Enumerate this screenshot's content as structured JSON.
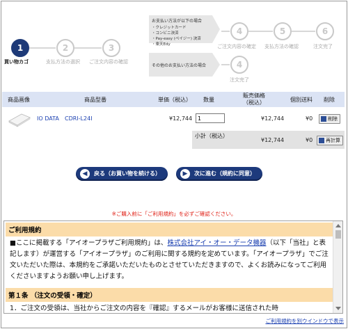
{
  "steps": {
    "s1": {
      "num": "1",
      "label": "買い物カゴ"
    },
    "s2": {
      "num": "2",
      "label": "支払方法の選択"
    },
    "s3": {
      "num": "3",
      "label": "ご注文内容の確認"
    },
    "pay_box_top": {
      "title": "お支払い方法が以下の場合",
      "items": [
        "・クレジットカード",
        "・コンビニ決済",
        "・Pay-easy (ペイジー) 決済",
        "・楽天Edy"
      ]
    },
    "pay_box_bottom": {
      "title": "その他のお支払い方法の場合"
    },
    "s4a": {
      "num": "4",
      "label": "ご注文内容の確定"
    },
    "s5": {
      "num": "5",
      "label": "支払方法の確認"
    },
    "s6": {
      "num": "6",
      "label": "注文完了"
    },
    "s4b": {
      "num": "4",
      "label": "注文完了"
    }
  },
  "table": {
    "headers": {
      "image": "商品画像",
      "model": "商品型番",
      "unit_price": "単価（税込）",
      "qty": "数量",
      "price_line1": "販売価格",
      "price_line2": "（税込）",
      "shipping": "個別送料",
      "delete": "削除"
    },
    "row": {
      "maker": "IO DATA",
      "model": "CDRI-L24I",
      "unit_price": "¥12,744",
      "qty": "1",
      "price": "¥12,744",
      "shipping": "¥0",
      "delete_btn": "削除"
    },
    "subtotal": {
      "label": "小計（税込）",
      "price": "¥12,744",
      "shipping": "¥0",
      "recalc_btn": "再計算"
    }
  },
  "nav": {
    "back": "戻る（お買い物を続ける）",
    "next": "次に進む（規約に同意）"
  },
  "notice": "※ご購入前に「ご利用規約」を必ずご確認ください。",
  "terms": {
    "heading": "ご利用規約",
    "para1_pre": "■ここに掲載する「アイオープラザご利用規約」は、",
    "para1_link": "株式会社アイ・オー・データ機器",
    "para1_post": "（以下「当社」と表記します）が運営する「アイオープラザ」のご利用に関する規約を定めています。「アイオープラザ」でご注文いただいた際は、本規約をご承諾いただいたものとさせていただきますので、よくお読みになってご利用くださいますようお願い申し上げます。",
    "article1_heading": "第１条 （注文の受領・確定）",
    "article1_text": "1．ご注文の受領は、当社からご注文の内容を『確認』するメールがお客様に送信された時"
  },
  "terms_link": "ご利用規約を別ウインドウで表示",
  "colors": {
    "navy": "#1d3a7c",
    "table_header": "#dbe3f4",
    "terms_heading": "#fbdca9",
    "notice_red": "#e0241a"
  }
}
